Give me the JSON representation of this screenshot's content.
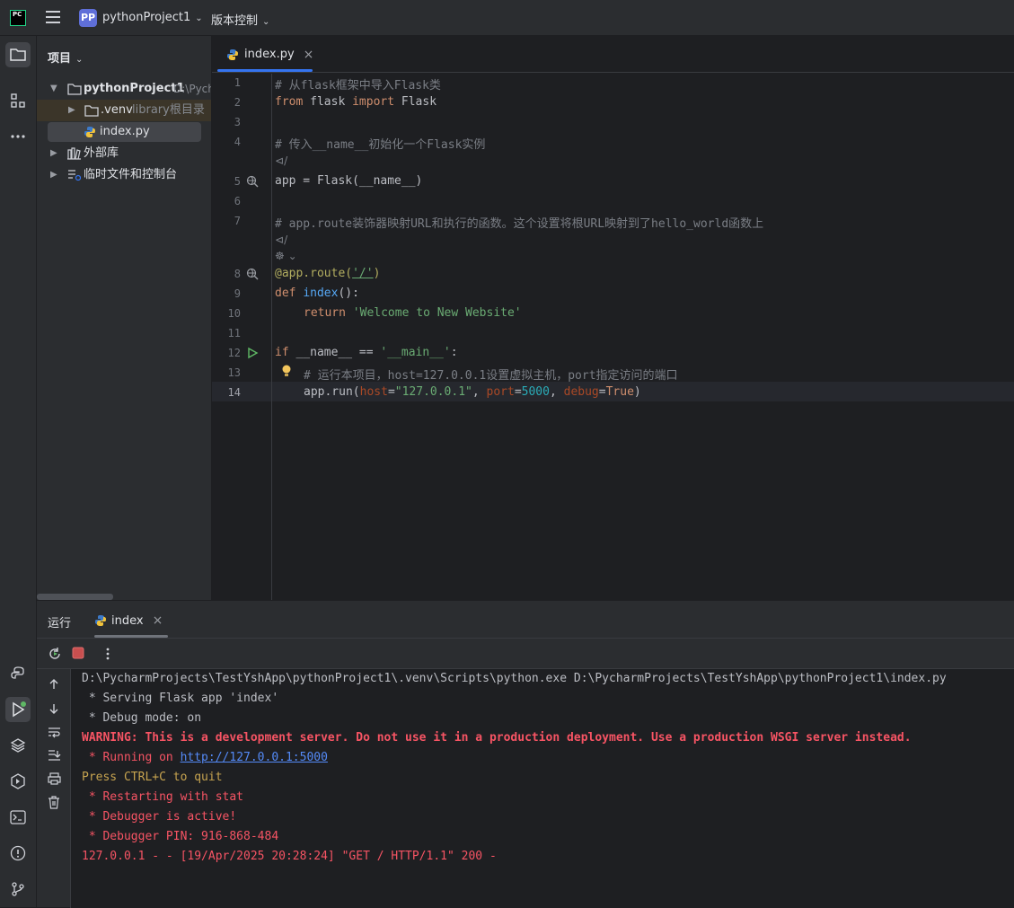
{
  "titlebar": {
    "logo_text": "PC",
    "project_badge": "PP",
    "project_name": "pythonProject1",
    "vcs_label": "版本控制"
  },
  "project_panel": {
    "title": "项目",
    "tree": [
      {
        "label": "pythonProject1",
        "hint": "D:\\Pych"
      },
      {
        "label": ".venv",
        "hint": "library根目录"
      },
      {
        "label": "index.py",
        "hint": ""
      },
      {
        "label": "外部库",
        "hint": ""
      },
      {
        "label": "临时文件和控制台",
        "hint": ""
      }
    ]
  },
  "editor": {
    "tab_label": "index.py",
    "line_numbers": [
      "1",
      "2",
      "3",
      "4",
      "5",
      "6",
      "7",
      "8",
      "9",
      "10",
      "11",
      "12",
      "13",
      "14"
    ],
    "lines": {
      "l1": "# 从flask框架中导入Flask类",
      "l2_kw1": "from",
      "l2_mid": " flask ",
      "l2_kw2": "import",
      "l2_end": " Flask",
      "l4": "# 传入__name__初始化一个Flask实例",
      "hint_a": "/",
      "l5": "app = Flask(__name__)",
      "l7": "# app.route装饰器映射URL和执行的函数。这个设置将根URL映射到了hello_world函数上",
      "hint_b": "/",
      "l8_dec": "@app.route(",
      "l8_str": "'/'",
      "l8_end": ")",
      "l9_kw": "def",
      "l9_fn": "index",
      "l9_end": "():",
      "l10_kw": "return",
      "l10_str": "'Welcome to New Website'",
      "l12_kw": "if",
      "l12_mid": " __name__ == ",
      "l12_str": "'__main__'",
      "l12_end": ":",
      "l13": "# 运行本项目，host=127.0.0.1设置虚拟主机，port指定访问的端口",
      "l14_a": "app.run(",
      "l14_p1": "host",
      "l14_eq1": "=",
      "l14_s1": "\"127.0.0.1\"",
      "l14_c1": ", ",
      "l14_p2": "port",
      "l14_eq2": "=",
      "l14_n": "5000",
      "l14_c2": ", ",
      "l14_p3": "debug",
      "l14_eq3": "=",
      "l14_v": "True",
      "l14_end": ")"
    }
  },
  "run_panel": {
    "label": "运行",
    "tab_label": "index",
    "console": [
      "D:\\PycharmProjects\\TestYshApp\\pythonProject1\\.venv\\Scripts\\python.exe D:\\PycharmProjects\\TestYshApp\\pythonProject1\\index.py",
      " * Serving Flask app 'index'",
      " * Debug mode: on",
      "WARNING: This is a development server. Do not use it in a production deployment. Use a production WSGI server instead.",
      " * Running on ",
      "http://127.0.0.1:5000",
      "Press CTRL+C to quit",
      " * Restarting with stat",
      " * Debugger is active!",
      " * Debugger PIN: 916-868-484",
      "127.0.0.1 - - [19/Apr/2025 20:28:24] \"GET / HTTP/1.1\" 200 -"
    ]
  },
  "colors": {
    "accent": "#3574f0",
    "comment": "#7a7e85",
    "keyword": "#cf8e6d",
    "string": "#6aab73",
    "error": "#f75464"
  }
}
